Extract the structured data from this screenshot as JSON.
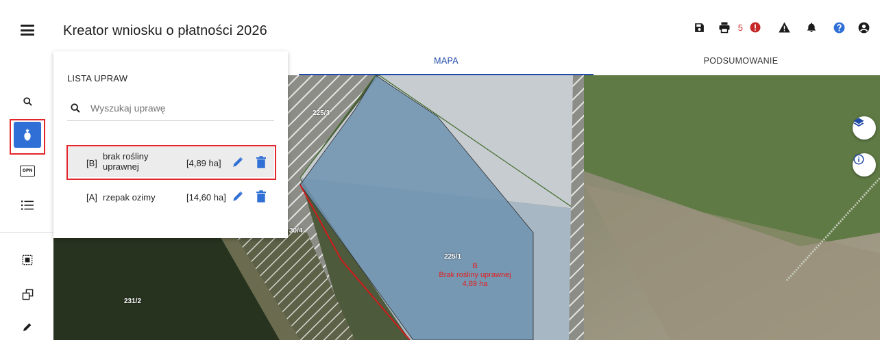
{
  "header": {
    "title": "Kreator wniosku o płatności 2026",
    "menu_icon": "hamburger-icon",
    "toolbar": {
      "save_icon": "save-icon",
      "print_icon": "print-icon",
      "error_count": "5",
      "error_icon": "error-circle-icon",
      "warning_icon": "warning-icon",
      "notifications_icon": "bell-icon",
      "help_icon": "help-icon",
      "account_icon": "account-icon"
    }
  },
  "tabs": [
    {
      "label": "MAPA",
      "active": true
    },
    {
      "label": "PODSUMOWANIE",
      "active": false
    }
  ],
  "rail": {
    "items": [
      "search-icon",
      "crop-icon",
      "opn-icon",
      "list-icon",
      "select-area-icon",
      "copy-icon",
      "pencil-icon"
    ],
    "opn_label": "OPN",
    "active": "crop-icon"
  },
  "panel": {
    "title": "LISTA UPRAW",
    "search_placeholder": "Wyszukaj uprawę",
    "crops": [
      {
        "code": "[B]",
        "name_line1": "brak rośliny",
        "name_line2": "uprawnej",
        "area": "[4,89 ha]",
        "selected": true
      },
      {
        "code": "[A]",
        "name_line1": "rzepak ozimy",
        "name_line2": "",
        "area": "[14,60 ha]",
        "selected": false
      }
    ]
  },
  "map": {
    "parcels": [
      "225/3",
      "30/4",
      "225/1",
      "231/2"
    ],
    "crop_label": {
      "code": "B",
      "name": "Brak rośliny uprawnej",
      "area": "4,89 ha"
    },
    "layers_icon": "layers-icon",
    "info_icon": "info-icon"
  },
  "colors": {
    "accent": "#1f4aa8",
    "active_rail": "#2f6fd6",
    "highlight": "#e3262b",
    "crop_label": "#e02020"
  }
}
